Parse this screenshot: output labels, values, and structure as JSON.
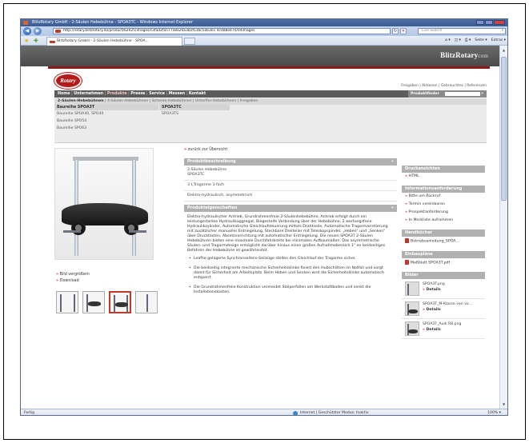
{
  "browser": {
    "title": "BlitzRotary GmbH - 2-Säulen Hebebühne - SPOA3TC - Windows Internet Explorer",
    "url": "http://rotary.blitzrotary.de/product/62025/images/c3fad2fa577a8a20a3b5f536c5a6301 4cdd8e475/04images",
    "search_placeholder": "Live Search",
    "tab_label": "BlitzRotary GmbH - 2-Säulen Hebebühne - SPOA...",
    "commands": [
      "Seite ▾",
      "Extras ▾"
    ],
    "status": "Fertig",
    "zone": "Internet | Geschützter Modus: Inaktiv",
    "zoom": "100% ▾"
  },
  "site": {
    "brand": "BlitzRotary",
    "brand_suffix": "com",
    "logo": "Rotary",
    "toplinks": "Freigaben | Aktionen | Gebrauchtes | Referenzen",
    "nav": [
      "Home",
      "Unternehmen",
      "Produkte",
      "Presse",
      "Service",
      "Messen",
      "Kontakt"
    ],
    "finder_label": "Produktfinder",
    "subnav": [
      "2-Säulen-Hebebühnen",
      "4-Säulen-Hebebühnen",
      "Scheren-Hebebühnen",
      "Unterflur-Hebebühnen",
      "Freigaben"
    ],
    "series": {
      "col1_head": "Baureihe SPOA3T",
      "col1_items": [
        "Baureihe SPOA40, SPO40",
        "Baureihe SPO54",
        "Baureihe SPO63"
      ],
      "col2_head": "SPOA3TC",
      "col2_items": [
        "SPOA3TS"
      ]
    },
    "left": {
      "zoom_link": "Bild vergrößern",
      "download_link": "Download"
    },
    "main": {
      "back": "zurück zur Übersicht",
      "desc_head": "Produktbeschreibung",
      "desc_rows": [
        "2-Säulen Hebebühne\nSPOA3TC",
        "3 t,Tragarme 3-fach",
        "Elektro-hydraulisch, asymmetrisch"
      ],
      "props_head": "Produkteigenschaften",
      "props_text": "Elektro-hydraulischer Antrieb, Grundrahmenfreie 2-Säulenhebebühne, Antrieb erfolgt durch ein leistungsstarkes Hydraulikaggregat, Biegesteife Verbindung über der Hebebühne, 2 wartungsfreie Hydraulikzylinder, Automatische Gleichlaufsteuerung mittels Drahtseile, Automatische Tragarmarretierung mit zusätzlicher manueller Entriegelung, Steckbare Dreiteiler mit Teleskopspindel, „Heben“ und „Senken“ über Drucktasten, Absetzvorrichtung mit automatischer Entriegelung. Die neuen SPOA3T 2-Säulen Hebebühnen bieten eine maximale Durchfahrbreite bei minimalen Aufbaumaßen. Das asymmetrische Säulen- und Tragarmdesign ermöglicht darüber hinaus einen großen Aufnahmebereich 1\" en beidseitiges Befahren der Hebebühne ist gewährleistet.",
      "bullets": [
        "Leafhe gelagerte Synchronseilens-Seilzüge stellen den Gleichlauf der Tragarme sicher.",
        "Die beidseitig integrierte mechanische Sicherheitsklinke fixiert den Hubschlitten im Notfall und sorgt damit für Sicherheit am Arbeitsplatz. Beim Heben und Senken wird die Sicherheitsklinke automatisch entsperrt.",
        "Die Grundrahmenfreie Konstruktion vermeidet Stolperfallen am Werkstattboden und senkt die Installationskosten."
      ]
    },
    "side": {
      "print_head": "Druckansichten",
      "print_items": [
        "HTML"
      ],
      "info_head": "Informationsanforderung",
      "info_items": [
        "Bitte um Rückruf",
        "Termin vereinbaren",
        "Prospektanforderung",
        "In Merkliste aufnehmen"
      ],
      "manual_head": "Handbücher",
      "manual_items": [
        "Betriebsanleitung_SPOA..."
      ],
      "plan_head": "Einbaupläne",
      "plan_items": [
        "Maßblatt SPOA3T.pdf"
      ],
      "pics_head": "Bilder",
      "pics": [
        {
          "name": "SPOA3T.png",
          "details": "Details"
        },
        {
          "name": "SPOA3T_M-Klasse von vo...",
          "details": "Details"
        },
        {
          "name": "SPOA3T_Audi R8.png",
          "details": "Details"
        }
      ]
    }
  }
}
